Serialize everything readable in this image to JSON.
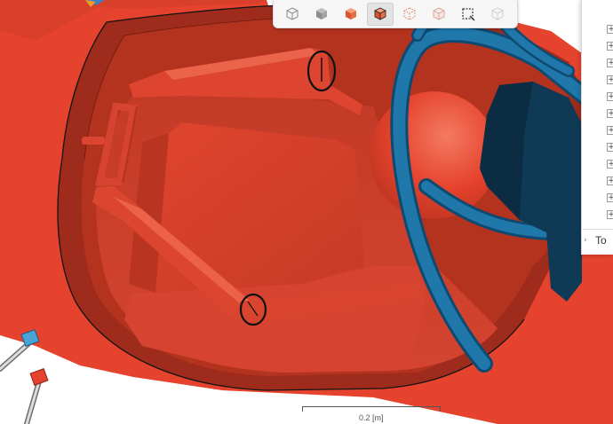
{
  "toolbar": {
    "buttons": [
      {
        "icon": "cube-wireframe-icon",
        "state": "normal"
      },
      {
        "icon": "cube-shaded-icon",
        "state": "normal"
      },
      {
        "icon": "cube-orange-icon",
        "state": "normal"
      },
      {
        "icon": "cube-orange-edges-icon",
        "state": "active"
      },
      {
        "icon": "cube-points-icon",
        "state": "normal"
      },
      {
        "icon": "cube-transparent-icon",
        "state": "normal"
      },
      {
        "icon": "box-select-icon",
        "state": "normal"
      },
      {
        "icon": "cube-disabled-icon",
        "state": "disabled"
      }
    ]
  },
  "tree_panel": {
    "expander_glyph": "+",
    "row_count": 12,
    "footer_label": "To",
    "footer_chevron": "›"
  },
  "scale": {
    "label": "0.2 [m]"
  },
  "colors": {
    "body": "#e5432d",
    "body_dark": "#a82d1c",
    "tube": "#1f77aa",
    "block": "#0f3a55",
    "edge": "#141414"
  }
}
